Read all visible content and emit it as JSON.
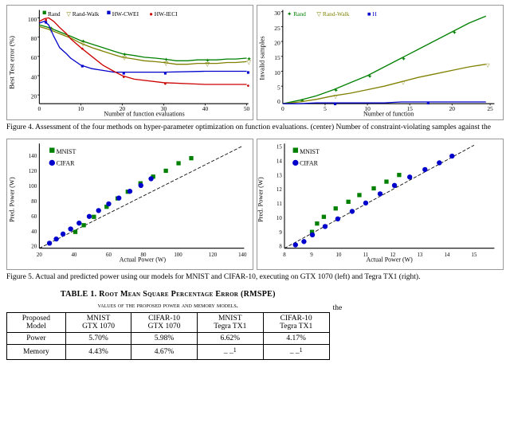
{
  "fig4": {
    "caption": "Figure 4.  Assessment of the four methods on hyper-parameter optimization on function evaluations. (center) Number of constraint-violating samples against the",
    "chart1": {
      "ylabel": "Best Test error (%)",
      "xlabel": "Number of function evaluations",
      "xmax": 50,
      "ymax": 100,
      "legend": [
        "Rand",
        "Rand-Walk",
        "HW-CWEI",
        "HW-IECI"
      ]
    },
    "chart2": {
      "ylabel": "Invalid samples",
      "xlabel": "Number of function",
      "xmax": 25,
      "ymax": 30,
      "legend": [
        "Rand",
        "Rand-Walk",
        "H"
      ]
    }
  },
  "fig5": {
    "caption": "Figure 5.  Actual and predicted power using our models for MNIST and CIFAR-10, executing on GTX 1070 (left) and Tegra TX1 (right).",
    "chart1": {
      "xlabel": "Actual Power (W)",
      "ylabel": "Pred. Power (W)",
      "xmin": 20,
      "xmax": 140,
      "ymin": 20,
      "ymax": 140
    },
    "chart2": {
      "xlabel": "Actual Power (W)",
      "ylabel": "Pred. Power (W)",
      "xmin": 8,
      "xmax": 15,
      "ymin": 8,
      "ymax": 15
    },
    "legend": [
      "MNIST",
      "CIFAR"
    ]
  },
  "table": {
    "title": "TABLE 1. Root Mean Square Percentage Error (RMSPE)",
    "subtitle": "values of the proposed power and memory models.",
    "headers": [
      "Proposed\nModel",
      "MNIST\nGTX 1070",
      "CIFAR-10\nGTX 1070",
      "MNIST\nTegra TX1",
      "CIFAR-10\nTegra TX1"
    ],
    "rows": [
      [
        "Power",
        "5.70%",
        "5.98%",
        "6.62%",
        "4.17%"
      ],
      [
        "Memory",
        "4.43%",
        "4.67%",
        "– –¹",
        "– –¹"
      ]
    ]
  },
  "the_text": "the"
}
